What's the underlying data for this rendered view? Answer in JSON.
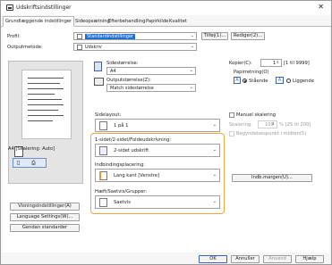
{
  "window": {
    "title": "Udskriftsindstillinger"
  },
  "tabs": [
    {
      "label": "Grundlæggende indstillinger",
      "active": true
    },
    {
      "label": "Sideopsætning"
    },
    {
      "label": "Efterbehandling"
    },
    {
      "label": "Papirkilde"
    },
    {
      "label": "Kvalitet"
    }
  ],
  "profile": {
    "label": "Profil:",
    "value": "Standardindstillinger",
    "add_label": "Tilføj(1)...",
    "edit_label": "Rediger(2)..."
  },
  "output_method": {
    "label": "Outputmetode:",
    "value": "Udskriv"
  },
  "preview": {
    "caption": "A4 [Skalering: Auto]",
    "view_settings_label": "Visningsindstillinger(A)",
    "language_label": "Language Settings(W)...",
    "restore_label": "Gendan standarder"
  },
  "page_size": {
    "label": "Sidestørrelse:",
    "value": "A4"
  },
  "output_size": {
    "label": "Outputstørrelse(Z):",
    "value": "Match sidestørrelse"
  },
  "copies": {
    "label": "Kopier(C):",
    "value": "1",
    "range": "[1 til 9999]"
  },
  "orientation": {
    "label": "Papirretning(O)",
    "portrait": "Stående",
    "landscape": "Liggende",
    "selected": "portrait"
  },
  "page_layout": {
    "label": "Sidelayout:",
    "value": "1 på 1"
  },
  "duplex": {
    "label": "1-sidet/2-sidet/Foldeudskrivning:",
    "value": "2-sidet udskrift"
  },
  "binding": {
    "label": "Indbindingsplacering:",
    "value": "Lang kant [Venstre]",
    "margin_button": "Indb.margen(U)..."
  },
  "manual_scaling": {
    "label": "Manuel skalering",
    "checked": false,
    "scaling_label": "Skalering:",
    "scaling_value": "100",
    "scaling_range": "% [25 til 200]",
    "origin_label": "Begyndelsespunkt i midten(5)"
  },
  "finishing": {
    "label": "Hæft/Saetvis/Grupper:",
    "value": "Saetvis"
  },
  "footer": {
    "ok": "OK",
    "cancel": "Annuller",
    "apply": "Anvend",
    "help": "Hjælp"
  }
}
